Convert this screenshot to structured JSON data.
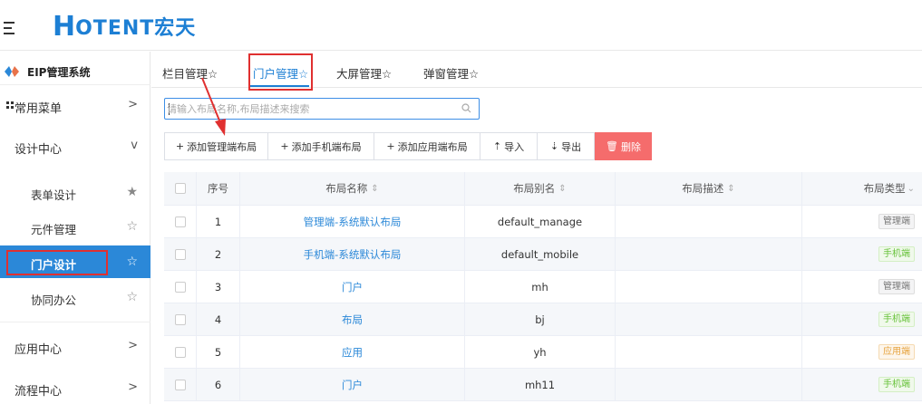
{
  "brand": {
    "logo_letter": "H",
    "logo_text": "OTENT宏天",
    "color": "#1d7fd4"
  },
  "sidebar": {
    "system_title": "EIP管理系统",
    "items": [
      {
        "label": "常用菜单",
        "arrow": ">"
      },
      {
        "label": "设计中心",
        "arrow": "v"
      },
      {
        "label": "表单设计",
        "star": "★"
      },
      {
        "label": "元件管理",
        "star": "☆"
      },
      {
        "label": "门户设计",
        "star": "☆"
      },
      {
        "label": "协同办公",
        "star": "☆"
      },
      {
        "label": "应用中心",
        "arrow": ">"
      },
      {
        "label": "流程中心",
        "arrow": ">"
      }
    ],
    "active_color": "#2b88d8"
  },
  "tabs": [
    {
      "label": "栏目管理☆"
    },
    {
      "label": "门户管理☆"
    },
    {
      "label": "大屏管理☆"
    },
    {
      "label": "弹窗管理☆"
    }
  ],
  "search": {
    "placeholder": "请输入布局名称,布局描述来搜索"
  },
  "toolbar": {
    "add_manage": "添加管理端布局",
    "add_mobile": "添加手机端布局",
    "add_app": "添加应用端布局",
    "import": "导入",
    "export": "导出",
    "delete": "删除"
  },
  "table": {
    "headers": {
      "index": "序号",
      "name": "布局名称",
      "alias": "布局别名",
      "desc": "布局描述",
      "type": "布局类型"
    },
    "rows": [
      {
        "index": "1",
        "name": "管理端-系统默认布局",
        "alias": "default_manage",
        "desc": "",
        "type": "管理端"
      },
      {
        "index": "2",
        "name": "手机端-系统默认布局",
        "alias": "default_mobile",
        "desc": "",
        "type": "手机端"
      },
      {
        "index": "3",
        "name": "门户",
        "alias": "mh",
        "desc": "",
        "type": "管理端"
      },
      {
        "index": "4",
        "name": "布局",
        "alias": "bj",
        "desc": "",
        "type": "手机端"
      },
      {
        "index": "5",
        "name": "应用",
        "alias": "yh",
        "desc": "",
        "type": "应用端"
      },
      {
        "index": "6",
        "name": "门户",
        "alias": "mh11",
        "desc": "",
        "type": "手机端"
      }
    ]
  },
  "colors": {
    "accent": "#2b88d8",
    "danger": "#f56c6c",
    "highlight": "#e03030"
  }
}
